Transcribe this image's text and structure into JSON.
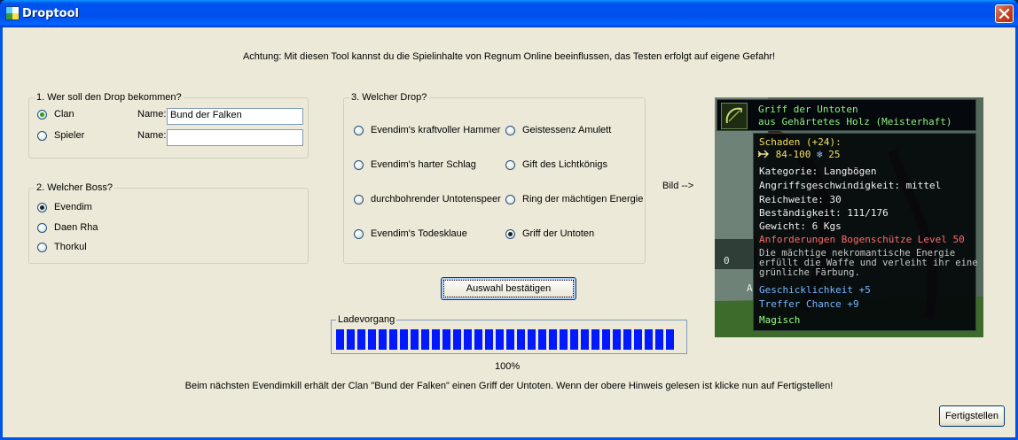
{
  "window": {
    "title": "Droptool"
  },
  "warning": "Achtung: Mit diesen Tool kannst du die Spielinhalte von Regnum Online beeinflussen, das Testen erfolgt auf eigene Gefahr!",
  "group1": {
    "legend": "1. Wer soll den Drop bekommen?",
    "options": [
      {
        "label": "Clan",
        "selected": true,
        "name_label": "Name:",
        "name_value": "Bund der Falken"
      },
      {
        "label": "Spieler",
        "selected": false,
        "name_label": "Name:",
        "name_value": ""
      }
    ]
  },
  "group2": {
    "legend": "2. Welcher Boss?",
    "options": [
      {
        "label": "Evendim",
        "selected": true
      },
      {
        "label": "Daen Rha",
        "selected": false
      },
      {
        "label": "Thorkul",
        "selected": false
      }
    ]
  },
  "group3": {
    "legend": "3. Welcher Drop?",
    "options": [
      {
        "label": "Evendim's kraftvoller Hammer",
        "selected": false
      },
      {
        "label": "Geistessenz Amulett",
        "selected": false
      },
      {
        "label": "Evendim's harter Schlag",
        "selected": false
      },
      {
        "label": "Gift des Lichtkönigs",
        "selected": false
      },
      {
        "label": "durchbohrender Untotenspeer",
        "selected": false
      },
      {
        "label": "Ring der mächtigen Energie",
        "selected": false
      },
      {
        "label": "Evendim's Todesklaue",
        "selected": false
      },
      {
        "label": "Griff der Untoten",
        "selected": true
      }
    ]
  },
  "bild_label": "Bild -->",
  "confirm_button": "Auswahl bestätigen",
  "progress": {
    "legend": "Ladevorgang",
    "percent_text": "100%",
    "value": 1.0
  },
  "status_text": "Beim nächsten Evendimkill erhält der Clan \"Bund der Falken\" einen Griff der Untoten. Wenn der obere Hinweis gelesen ist klicke nun auf Fertigstellen!",
  "finish_button": "Fertigstellen",
  "tooltip": {
    "name_line1": "Griff der Untoten",
    "name_line2": "aus Gehärtetes Holz (Meisterhaft)",
    "damage_header": "Schaden (+24):",
    "damage_value": "84-100",
    "frost_value": "25",
    "kategorie": "Kategorie: Langbögen",
    "angriff": "Angriffsgeschwindigkeit: mittel",
    "reichweite": "Reichweite: 30",
    "bestaendigkeit": "Beständigkeit: 111/176",
    "gewicht": "Gewicht: 6 Kgs",
    "anforderungen": "Anforderungen Bogenschütze Level 50",
    "desc1": "Die mächtige nekromantische Energie",
    "desc2": "erfüllt die Waffe und verleiht ihr eine",
    "desc3": "grünliche Färbung.",
    "bonus1": "Geschicklichkeit +5",
    "bonus2": "Treffer Chance +9",
    "magic": "Magisch",
    "bg_fragment1": "0",
    "bg_fragment2": "A"
  },
  "colors": {
    "progress_bar": "#0019ff",
    "titlebar": "#0054e3"
  }
}
